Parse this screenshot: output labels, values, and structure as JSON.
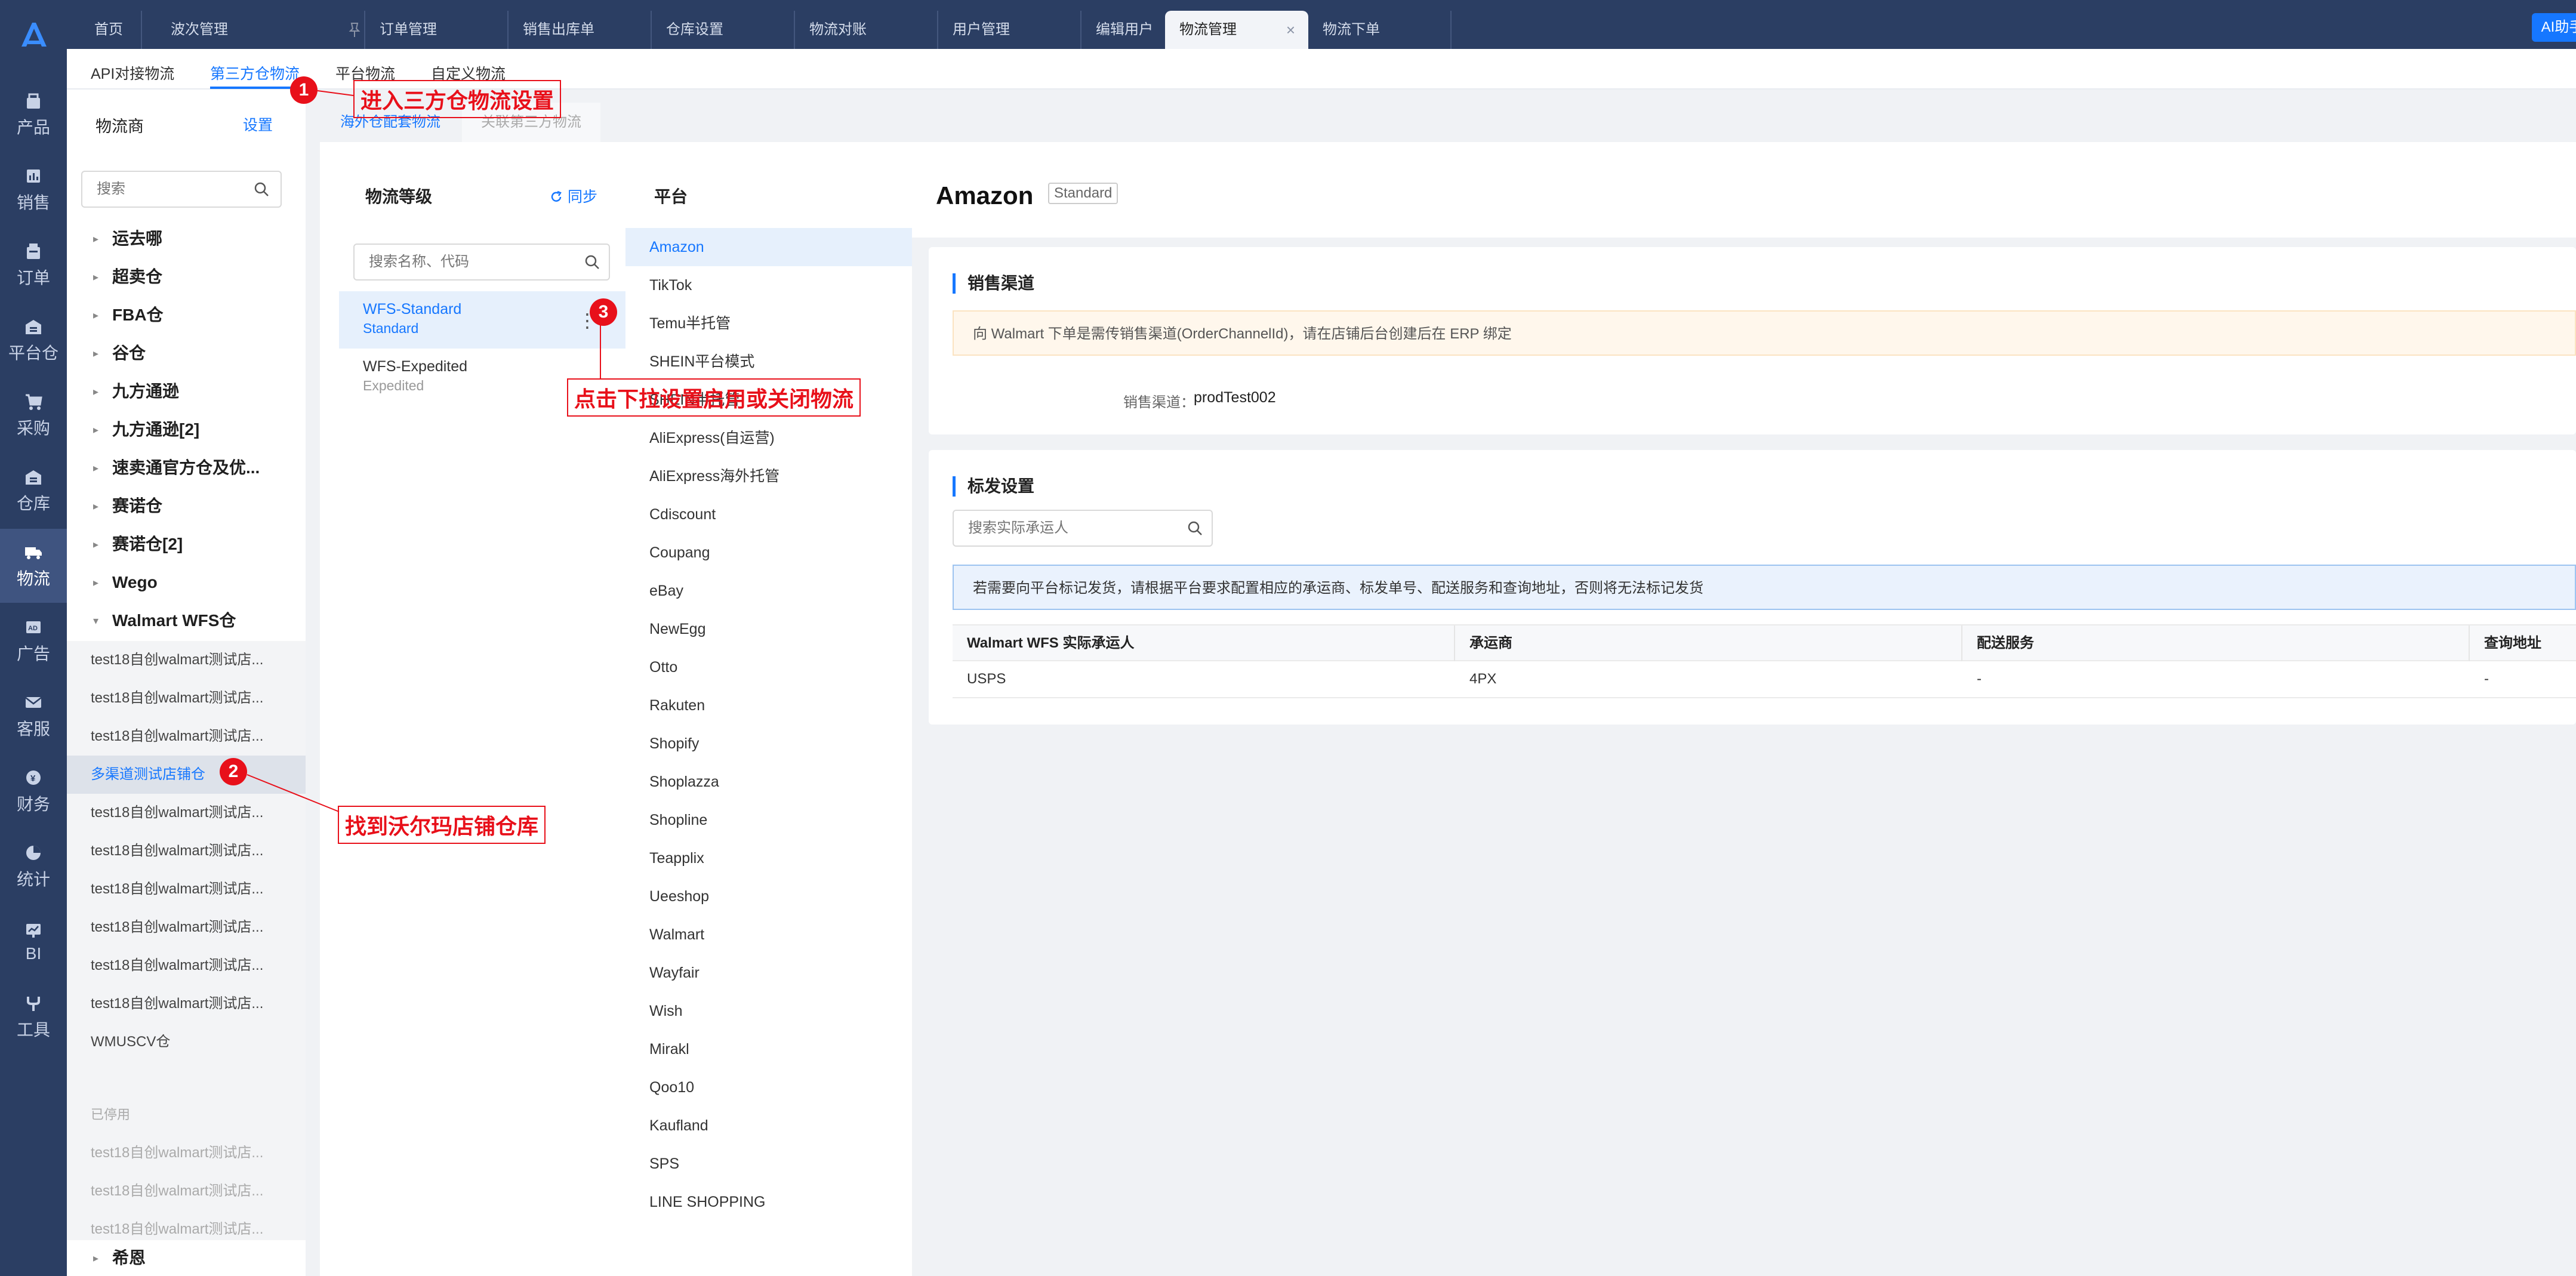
{
  "top_tabs": [
    {
      "label": "首页"
    },
    {
      "label": "波次管理"
    },
    {
      "label": "订单管理"
    },
    {
      "label": "销售出库单"
    },
    {
      "label": "仓库设置"
    },
    {
      "label": "物流对账"
    },
    {
      "label": "用户管理"
    },
    {
      "label": "编辑用户"
    },
    {
      "label": "物流管理",
      "close": "×"
    },
    {
      "label": "物流下单"
    }
  ],
  "ai_button": "AI助手",
  "left_nav": [
    {
      "label": "产品",
      "icon": "box-icon"
    },
    {
      "label": "销售",
      "icon": "chart-icon"
    },
    {
      "label": "订单",
      "icon": "order-icon"
    },
    {
      "label": "平台仓",
      "icon": "warehouse-icon"
    },
    {
      "label": "采购",
      "icon": "cart-icon"
    },
    {
      "label": "仓库",
      "icon": "warehouse-icon"
    },
    {
      "label": "物流",
      "icon": "truck-icon"
    },
    {
      "label": "广告",
      "icon": "ad-icon"
    },
    {
      "label": "客服",
      "icon": "mail-icon"
    },
    {
      "label": "财务",
      "icon": "finance-icon"
    },
    {
      "label": "统计",
      "icon": "pie-icon"
    },
    {
      "label": "BI",
      "icon": "bi-icon"
    },
    {
      "label": "工具",
      "icon": "tool-icon"
    }
  ],
  "sub_tabs": [
    "API对接物流",
    "第三方仓物流",
    "平台物流",
    "自定义物流"
  ],
  "carrier_panel": {
    "title": "物流商",
    "setting": "设置",
    "search_placeholder": "搜索",
    "groups": [
      "运去哪",
      "超卖仓",
      "FBA仓",
      "谷仓",
      "九方通逊",
      "九方通逊[2]",
      "速卖通官方仓及优...",
      "赛诺仓",
      "赛诺仓[2]",
      "Wego",
      "Walmart WFS仓"
    ],
    "walmart_items": [
      "test18自创walmart测试店...",
      "test18自创walmart测试店...",
      "test18自创walmart测试店...",
      "多渠道测试店铺仓",
      "test18自创walmart测试店...",
      "test18自创walmart测试店...",
      "test18自创walmart测试店...",
      "test18自创walmart测试店...",
      "test18自创walmart测试店...",
      "test18自创walmart测试店...",
      "WMUSCV仓"
    ],
    "disabled_label": "已停用",
    "disabled_items": [
      "test18自创walmart测试店...",
      "test18自创walmart测试店...",
      "test18自创walmart测试店..."
    ],
    "last_group": "希恩"
  },
  "content_tabs": [
    "海外仓配套物流",
    "关联第三方物流"
  ],
  "level_panel": {
    "title": "物流等级",
    "sync": "同步",
    "search_placeholder": "搜索名称、代码",
    "items": [
      {
        "name": "WFS-Standard",
        "code": "Standard"
      },
      {
        "name": "WFS-Expedited",
        "code": "Expedited"
      }
    ]
  },
  "platform_panel": {
    "title": "平台",
    "items": [
      "Amazon",
      "TikTok",
      "Temu半托管",
      "SHEIN平台模式",
      "SHEIN半托管",
      "AliExpress(自运营)",
      "AliExpress海外托管",
      "Cdiscount",
      "Coupang",
      "eBay",
      "NewEgg",
      "Otto",
      "Rakuten",
      "Shopify",
      "Shoplazza",
      "Shopline",
      "Teapplix",
      "Ueeshop",
      "Walmart",
      "Wayfair",
      "Wish",
      "Mirakl",
      "Qoo10",
      "Kaufland",
      "SPS",
      "LINE SHOPPING"
    ]
  },
  "detail": {
    "title": "Amazon",
    "badge": "Standard",
    "sales_channel": {
      "title": "销售渠道",
      "notice": "向 Walmart 下单是需传销售渠道(OrderChannelId)，请在店铺后台创建后在 ERP 绑定",
      "label": "销售渠道：",
      "value": "prodTest002"
    },
    "mark_settings": {
      "title": "标发设置",
      "search_placeholder": "搜索实际承运人",
      "notice": "若需要向平台标记发货，请根据平台要求配置相应的承运商、标发单号、配送服务和查询地址，否则将无法标记发货",
      "columns": [
        "Walmart WFS 实际承运人",
        "承运商",
        "配送服务",
        "查询地址"
      ],
      "rows": [
        [
          "USPS",
          "4PX",
          "-",
          "-"
        ]
      ]
    }
  },
  "annotations": [
    {
      "num": "1",
      "text": "进入三方仓物流设置"
    },
    {
      "num": "2",
      "text": "找到沃尔玛店铺仓库"
    },
    {
      "num": "3",
      "text": "点击下拉设置启用或关闭物流"
    }
  ],
  "colors": {
    "primary": "#1677ff",
    "nav_bg": "#2b3e63",
    "annotation": "#e8101a"
  }
}
